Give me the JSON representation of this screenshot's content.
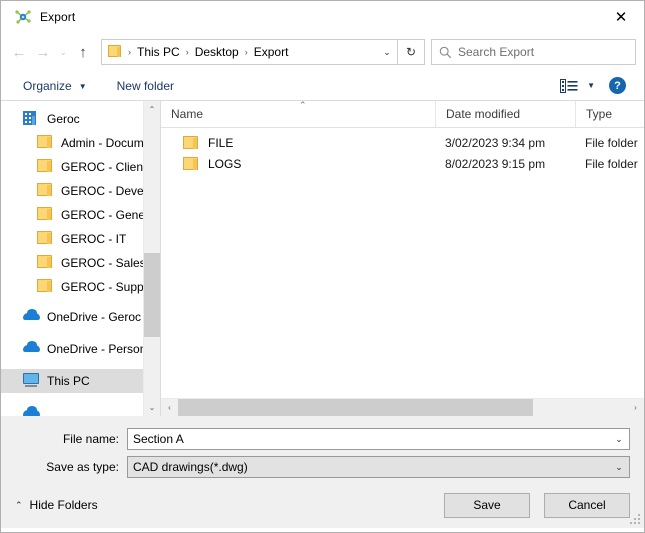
{
  "window": {
    "title": "Export",
    "icon": "export-app-icon",
    "close_label": "✕"
  },
  "nav": {
    "back_icon": "←",
    "forward_icon": "→",
    "recent_icon": "⌄",
    "up_icon": "↑",
    "breadcrumb": [
      "This PC",
      "Desktop",
      "Export"
    ],
    "separator": "›",
    "dropdown_icon": "⌄",
    "refresh_icon": "↻"
  },
  "search": {
    "placeholder": "Search Export",
    "icon": "search-icon"
  },
  "toolbar": {
    "organize_label": "Organize",
    "organize_caret": "▼",
    "new_folder_label": "New folder",
    "view_caret": "▼",
    "help_label": "?"
  },
  "sidebar": {
    "items": [
      {
        "label": "Geroc",
        "icon": "building-icon",
        "indent": false,
        "selected": false
      },
      {
        "label": "Admin - Docum",
        "icon": "folder-icon",
        "indent": true,
        "selected": false
      },
      {
        "label": "GEROC - Clients",
        "icon": "folder-icon",
        "indent": true,
        "selected": false
      },
      {
        "label": "GEROC - Develo",
        "icon": "folder-icon",
        "indent": true,
        "selected": false
      },
      {
        "label": "GEROC - Genera",
        "icon": "folder-icon",
        "indent": true,
        "selected": false
      },
      {
        "label": "GEROC - IT",
        "icon": "folder-icon",
        "indent": true,
        "selected": false
      },
      {
        "label": "GEROC - Sales",
        "icon": "folder-icon",
        "indent": true,
        "selected": false
      },
      {
        "label": "GEROC - Suppor",
        "icon": "folder-icon",
        "indent": true,
        "selected": false
      },
      {
        "label": "OneDrive - Geroc",
        "icon": "cloud-icon",
        "indent": false,
        "selected": false
      },
      {
        "label": "OneDrive - Person",
        "icon": "cloud-icon",
        "indent": false,
        "selected": false
      },
      {
        "label": "This PC",
        "icon": "monitor-icon",
        "indent": false,
        "selected": true
      }
    ],
    "scroll_up_icon": "⌃",
    "scroll_down_icon": "⌄"
  },
  "filelist": {
    "columns": [
      "Name",
      "Date modified",
      "Type"
    ],
    "sort_indicator": "⌃",
    "rows": [
      {
        "name": "FILE",
        "date_modified": "3/02/2023 9:34 pm",
        "type": "File folder",
        "icon": "folder-icon"
      },
      {
        "name": "LOGS",
        "date_modified": "8/02/2023 9:15 pm",
        "type": "File folder",
        "icon": "folder-icon"
      }
    ],
    "scroll_left_icon": "‹",
    "scroll_right_icon": "›"
  },
  "form": {
    "filename_label": "File name:",
    "filename_value": "Section A",
    "filetype_label": "Save as type:",
    "filetype_value": "CAD drawings(*.dwg)",
    "caret_icon": "⌄"
  },
  "footer": {
    "hide_folders_label": "Hide Folders",
    "hide_folders_caret": "⌃",
    "save_label": "Save",
    "cancel_label": "Cancel"
  },
  "colors": {
    "accent_blue": "#1666ad",
    "folder_yellow": "#fcd775",
    "onedrive_blue": "#1b7fd4",
    "chrome_gray": "#f0f0f0",
    "selection_gray": "#dcdcdc"
  }
}
